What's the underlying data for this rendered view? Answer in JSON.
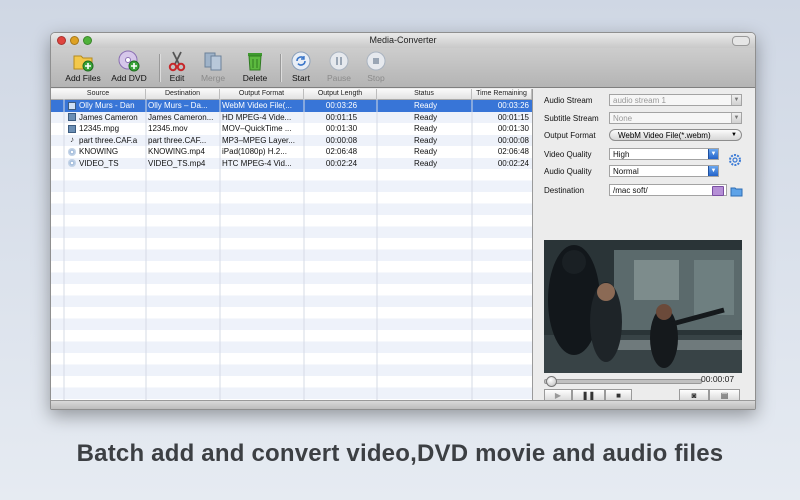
{
  "window": {
    "title": "Media-Converter"
  },
  "toolbar": {
    "add_files": "Add Files",
    "add_dvd": "Add DVD",
    "edit": "Edit",
    "merge": "Merge",
    "delete": "Delete",
    "start": "Start",
    "pause": "Pause",
    "stop": "Stop"
  },
  "table": {
    "headers": {
      "source": "Source",
      "destination": "Destination",
      "format": "Output Format",
      "length": "Output Length",
      "status": "Status",
      "remaining": "Time Remaining"
    },
    "rows": [
      {
        "icon": "film-icon",
        "source": "Olly Murs - Dan",
        "destination": "Olly Murs – Da...",
        "format": "WebM Video File(...",
        "length": "00:03:26",
        "status": "Ready",
        "remaining": "00:03:26"
      },
      {
        "icon": "film-icon",
        "source": "James Cameron",
        "destination": "James Cameron...",
        "format": "HD MPEG-4 Vide...",
        "length": "00:01:15",
        "status": "Ready",
        "remaining": "00:01:15"
      },
      {
        "icon": "film-icon",
        "source": "12345.mpg",
        "destination": "12345.mov",
        "format": "MOV–QuickTime ...",
        "length": "00:01:30",
        "status": "Ready",
        "remaining": "00:01:30"
      },
      {
        "icon": "music-note-icon",
        "source": "part three.CAF.a",
        "destination": "part three.CAF...",
        "format": "MP3–MPEG Layer...",
        "length": "00:00:08",
        "status": "Ready",
        "remaining": "00:00:08"
      },
      {
        "icon": "disc-icon",
        "source": "KNOWING",
        "destination": "KNOWING.mp4",
        "format": "iPad(1080p) H.2...",
        "length": "02:06:48",
        "status": "Ready",
        "remaining": "02:06:48"
      },
      {
        "icon": "disc-icon",
        "source": "VIDEO_TS",
        "destination": "VIDEO_TS.mp4",
        "format": "HTC MPEG-4 Vid...",
        "length": "00:02:24",
        "status": "Ready",
        "remaining": "00:02:24"
      }
    ]
  },
  "settings": {
    "audio_stream_label": "Audio Stream",
    "audio_stream_value": "audio stream 1",
    "subtitle_label": "Subtitle Stream",
    "subtitle_value": "None",
    "output_format_label": "Output Format",
    "output_format_value": "WebM Video File(*.webm)",
    "video_quality_label": "Video Quality",
    "video_quality_value": "High",
    "audio_quality_label": "Audio Quality",
    "audio_quality_value": "Normal",
    "destination_label": "Destination",
    "destination_value": "/mac soft/"
  },
  "player": {
    "time": "00:00:07",
    "progress": 0.02
  },
  "caption": "Batch add and convert video,DVD movie and audio files"
}
